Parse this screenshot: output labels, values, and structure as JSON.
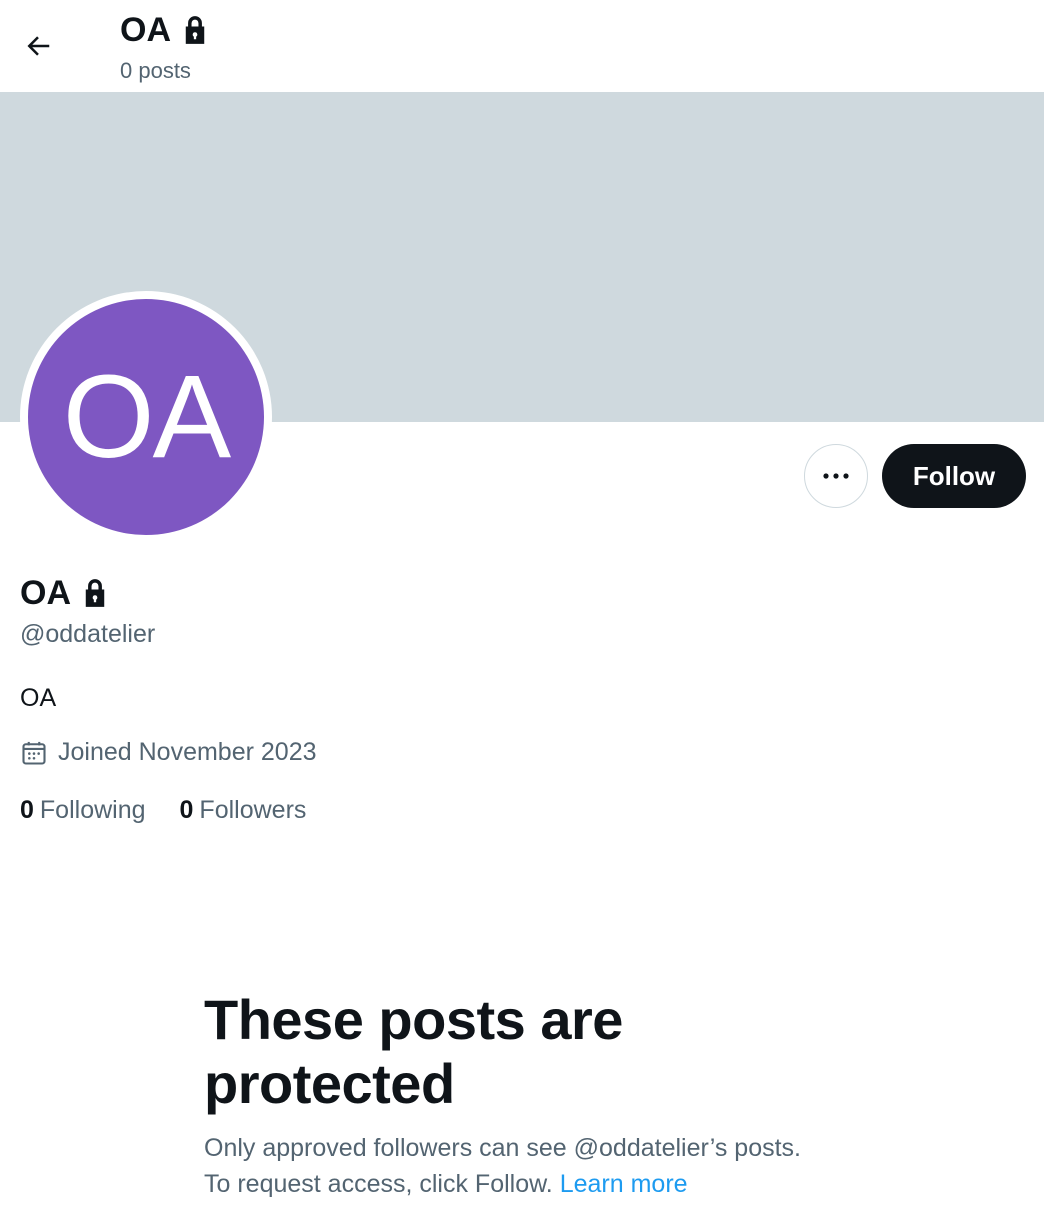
{
  "header": {
    "title": "OA",
    "post_count": "0 posts",
    "back_icon": "arrow-left-icon",
    "lock_icon": "lock-icon"
  },
  "profile": {
    "avatar_initials": "OA",
    "avatar_color": "#7e57c2",
    "banner_color": "#cfd9de",
    "display_name": "OA",
    "handle": "@oddatelier",
    "bio": "OA",
    "joined": "Joined November 2023",
    "following_count": "0",
    "following_label": "Following",
    "followers_count": "0",
    "followers_label": "Followers"
  },
  "actions": {
    "more_icon": "more-horizontal-icon",
    "follow_label": "Follow"
  },
  "protected": {
    "title": "These posts are protected",
    "body": "Only approved followers can see @oddatelier’s posts. To request access, click Follow.",
    "learn_more": "Learn more"
  },
  "colors": {
    "accent": "#1d9bf0",
    "text_primary": "#0f1419",
    "text_secondary": "#536471"
  }
}
